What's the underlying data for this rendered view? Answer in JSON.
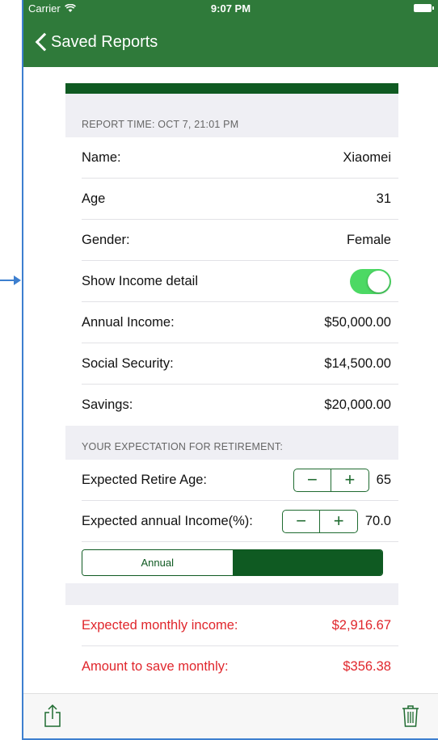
{
  "status_bar": {
    "carrier": "Carrier",
    "time": "9:07 PM"
  },
  "nav": {
    "back_label": "Saved Reports"
  },
  "report": {
    "time_header": "REPORT TIME: OCT 7, 21:01 PM",
    "rows": [
      {
        "label": "Name:",
        "value": "Xiaomei"
      },
      {
        "label": "Age",
        "value": "31"
      },
      {
        "label": "Gender:",
        "value": "Female"
      }
    ],
    "show_income": {
      "label": "Show Income detail",
      "on": true
    },
    "income_rows": [
      {
        "label": "Annual Income:",
        "value": "$50,000.00"
      },
      {
        "label": "Social Security:",
        "value": "$14,500.00"
      },
      {
        "label": "Savings:",
        "value": "$20,000.00"
      }
    ]
  },
  "expectation": {
    "header": "YOUR EXPECTATION FOR RETIREMENT:",
    "retire_age": {
      "label": "Expected Retire Age:",
      "value": "65",
      "minus": "−",
      "plus": "+"
    },
    "annual_income_pct": {
      "label": "Expected annual Income(%):",
      "value": "70.0",
      "minus": "−",
      "plus": "+"
    },
    "segment": {
      "option_a": "Annual",
      "option_b": "",
      "selected": "option_b"
    }
  },
  "results": [
    {
      "label": "Expected monthly income:",
      "value": "$2,916.67"
    },
    {
      "label": "Amount to save monthly:",
      "value": "$356.38"
    }
  ],
  "toolbar": {
    "share_icon": "share-icon",
    "trash_icon": "trash-icon"
  },
  "colors": {
    "nav_green": "#2f7a3a",
    "accent_green": "#0f5a22",
    "toggle_green": "#4cd964",
    "result_red": "#e0262c"
  }
}
